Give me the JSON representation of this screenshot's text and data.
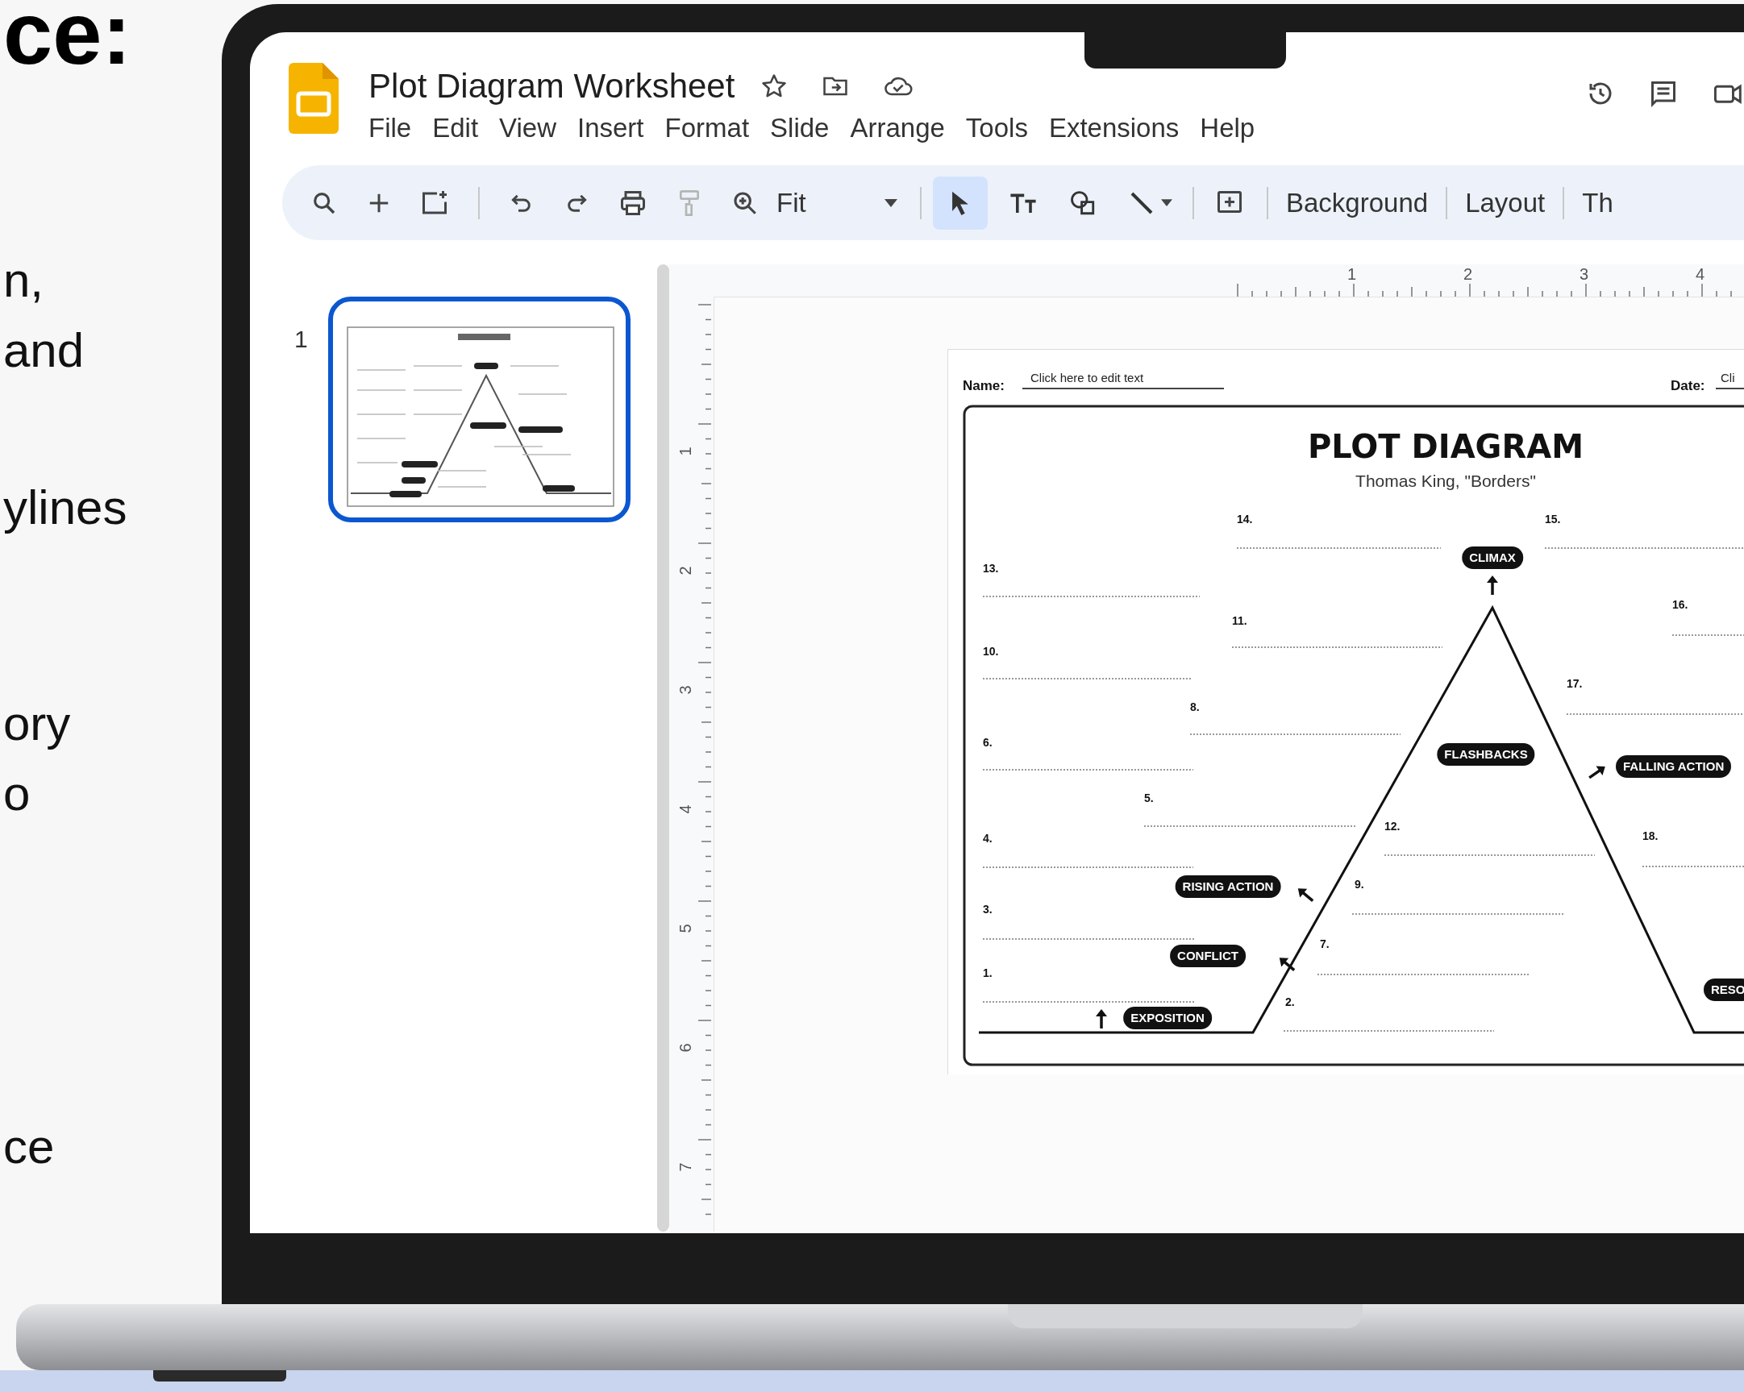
{
  "page_text": [
    {
      "text": "ce:",
      "kind": "heading"
    },
    {
      "text": "n,",
      "kind": "body"
    },
    {
      "text": "and",
      "kind": "body"
    },
    {
      "text": "ylines",
      "kind": "body"
    },
    {
      "text": "ory",
      "kind": "body"
    },
    {
      "text": "o",
      "kind": "body"
    },
    {
      "text": "ce",
      "kind": "body"
    }
  ],
  "app": {
    "title": "Plot Diagram Worksheet",
    "menu": [
      "File",
      "Edit",
      "View",
      "Insert",
      "Format",
      "Slide",
      "Arrange",
      "Tools",
      "Extensions",
      "Help"
    ]
  },
  "toolbar": {
    "zoom": "Fit",
    "paint_format": {
      "disabled": true
    },
    "tools": [
      {
        "selected": true
      },
      {
        "selected": false
      },
      {
        "selected": false
      },
      {
        "selected": false
      }
    ],
    "buttons": [
      "Background",
      "Layout",
      "Th"
    ]
  },
  "slides": [
    {
      "number": "1",
      "selected": true
    }
  ],
  "rulers": {
    "horizontal": [
      "1",
      "2",
      "3",
      "4"
    ],
    "vertical": [
      "1",
      "2",
      "3",
      "4",
      "5",
      "6",
      "7"
    ]
  },
  "worksheet": {
    "name_label": "Name:",
    "name_value": "Click here to edit text",
    "date_label": "Date:",
    "date_value": "Cli",
    "title": "PLOT DIAGRAM",
    "subtitle": "Thomas King, \"Borders\"",
    "stages": [
      "CLIMAX",
      "FLASHBACKS",
      "FALLING ACTION",
      "RISING ACTION",
      "CONFLICT",
      "EXPOSITION",
      "RESO"
    ],
    "prompts": [
      "14.",
      "15.",
      "13.",
      "11.",
      "16.",
      "10.",
      "17.",
      "8.",
      "6.",
      "5.",
      "12.",
      "18.",
      "4.",
      "9.",
      "3.",
      "7.",
      "1.",
      "2."
    ]
  }
}
